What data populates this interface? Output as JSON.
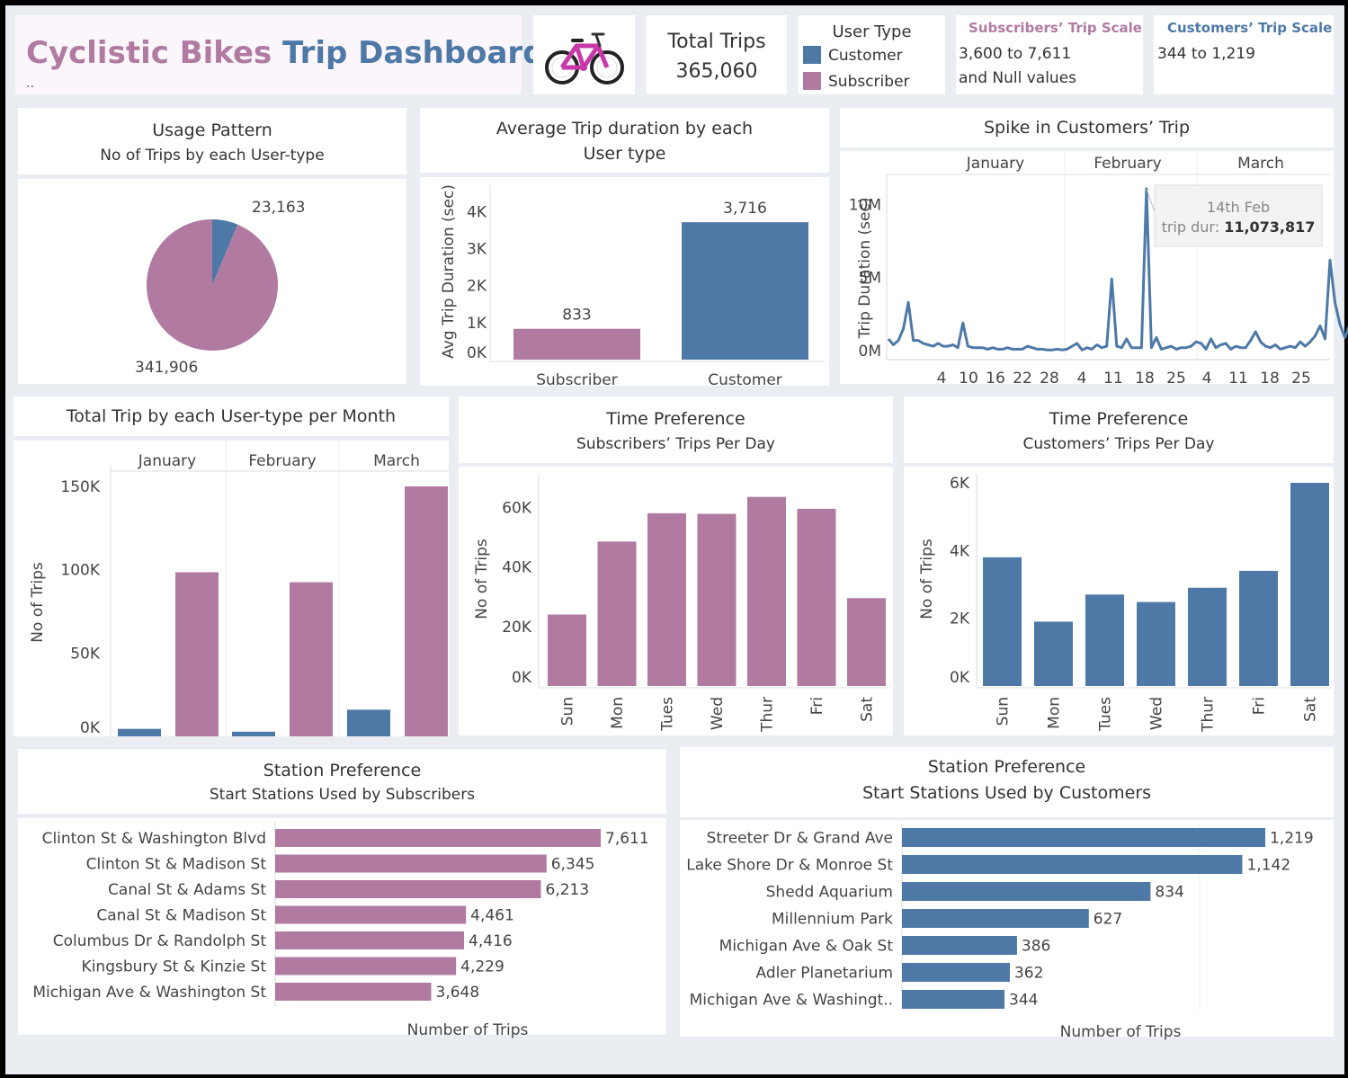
{
  "colors": {
    "customer": "#4e79a7",
    "subscriber": "#b07aa1"
  },
  "header": {
    "title_part1": "Cyclistic Bikes",
    "title_part2": "Trip Dashboard",
    "subtitle": "..",
    "bike_icon": "bicycle-icon",
    "total_label": "Total Trips",
    "total_value": "365,060",
    "legend_title": "User Type",
    "legend_items": [
      "Customer",
      "Subscriber"
    ],
    "sub_scale_title": "Subscribers’ Trip Scale",
    "sub_scale_line1": "3,600 to 7,611",
    "sub_scale_line2": "and Null values",
    "cust_scale_title": "Customers’ Trip Scale",
    "cust_scale_line1": "344 to 1,219"
  },
  "usage": {
    "title": "Usage Pattern",
    "subtitle": "No of Trips by each User-type"
  },
  "avg": {
    "title_line1": "Average Trip duration by each",
    "title_line2": "User type"
  },
  "spike": {
    "title": "Spike in Customers’ Trip",
    "tooltip_date": "14th Feb",
    "tooltip_label": "trip dur:",
    "tooltip_value": "11,073,817"
  },
  "monthly": {
    "title": "Total Trip by each User-type per Month"
  },
  "tp_sub": {
    "title": "Time Preference",
    "subtitle": "Subscribers’ Trips Per Day"
  },
  "tp_cust": {
    "title": "Time Preference",
    "subtitle": "Customers’ Trips Per Day"
  },
  "st_sub": {
    "title": "Station Preference",
    "subtitle": "Start Stations Used by Subscribers"
  },
  "st_cust": {
    "title": "Station Preference",
    "subtitle": "Start Stations Used by Customers"
  },
  "chart_data": [
    {
      "id": "usage_pie",
      "type": "pie",
      "labels": [
        "Customer",
        "Subscriber"
      ],
      "values": [
        23163,
        341906
      ],
      "value_labels": [
        "23,163",
        "341,906"
      ]
    },
    {
      "id": "avg_duration",
      "type": "bar",
      "categories": [
        "Subscriber",
        "Customer"
      ],
      "values": [
        833,
        3716
      ],
      "value_labels": [
        "833",
        "3,716"
      ],
      "ylabel": "Avg Trip Duration (sec)",
      "ylim": [
        0,
        4400
      ],
      "yticks": [
        0,
        1000,
        2000,
        3000,
        4000
      ],
      "ytick_labels": [
        "0K",
        "1K",
        "2K",
        "3K",
        "4K"
      ]
    },
    {
      "id": "spike_line",
      "type": "line",
      "months": [
        "January",
        "February",
        "March"
      ],
      "ylabel": "Trip Duration (sec)",
      "ylim": [
        0,
        11500000
      ],
      "yticks": [
        0,
        5000000,
        10000000
      ],
      "ytick_labels": [
        "0M",
        "5M",
        "10M"
      ],
      "x_tick_labels": [
        "4",
        "10",
        "16",
        "22",
        "28",
        "4",
        "11",
        "18",
        "25",
        "4",
        "11",
        "18",
        "25"
      ],
      "x": [
        1,
        2,
        3,
        4,
        5,
        6,
        7,
        8,
        9,
        10,
        11,
        12,
        13,
        14,
        15,
        16,
        17,
        18,
        19,
        20,
        21,
        22,
        23,
        24,
        25,
        26,
        27,
        28,
        29,
        30,
        31,
        32,
        33,
        34,
        35,
        36,
        37,
        38,
        39,
        40,
        41,
        42,
        43,
        44,
        45,
        46,
        47,
        48,
        49,
        50,
        51,
        52,
        53,
        54,
        55,
        56,
        57,
        58,
        59,
        60,
        61,
        62,
        63,
        64,
        65,
        66,
        67,
        68,
        69,
        70,
        71,
        72,
        73,
        74,
        75,
        76,
        77,
        78,
        79,
        80,
        81,
        82,
        83,
        84,
        85,
        86,
        87,
        88,
        89,
        90
      ],
      "y": [
        800000,
        400000,
        700000,
        1500000,
        3300000,
        700000,
        700000,
        500000,
        400000,
        300000,
        500000,
        300000,
        300000,
        400000,
        200000,
        1900000,
        300000,
        200000,
        200000,
        200000,
        100000,
        200000,
        100000,
        100000,
        200000,
        100000,
        100000,
        100000,
        300000,
        200000,
        100000,
        100000,
        50000,
        50000,
        100000,
        50000,
        100000,
        300000,
        500000,
        50000,
        200000,
        100000,
        400000,
        200000,
        300000,
        4900000,
        300000,
        200000,
        800000,
        200000,
        200000,
        200000,
        11073817,
        200000,
        900000,
        100000,
        200000,
        300000,
        100000,
        200000,
        200000,
        300000,
        600000,
        500000,
        100000,
        800000,
        200000,
        400000,
        500000,
        100000,
        300000,
        200000,
        200000,
        700000,
        1300000,
        600000,
        300000,
        200000,
        400000,
        100000,
        200000,
        300000,
        200000,
        600000,
        300000,
        600000,
        1000000,
        1700000,
        800000,
        6200000,
        3300000,
        1800000,
        900000,
        1800000,
        700000,
        300000,
        1000000,
        6200000,
        2100000,
        900000,
        1600000,
        3300000,
        2800000,
        5600000,
        2800000,
        1000000
      ]
    },
    {
      "id": "monthly",
      "type": "bar",
      "categories": [
        "January",
        "February",
        "March"
      ],
      "series": [
        {
          "name": "Customer",
          "values": [
            4500,
            2800,
            16000
          ]
        },
        {
          "name": "Subscriber",
          "values": [
            98500,
            92500,
            150000
          ]
        }
      ],
      "ylabel": "No of Trips",
      "ylim": [
        0,
        150000
      ],
      "yticks": [
        0,
        50000,
        100000,
        150000
      ],
      "ytick_labels": [
        "0K",
        "50K",
        "100K",
        "150K"
      ]
    },
    {
      "id": "subs_day",
      "type": "bar",
      "categories": [
        "Sun",
        "Mon",
        "Tues",
        "Wed",
        "Thur",
        "Fri",
        "Sat"
      ],
      "values": [
        24000,
        48500,
        58000,
        57800,
        63500,
        59500,
        29500
      ],
      "ylabel": "No of Trips",
      "ylim": [
        0,
        64000
      ],
      "yticks": [
        0,
        20000,
        40000,
        60000
      ],
      "ytick_labels": [
        "0K",
        "20K",
        "40K",
        "60K"
      ]
    },
    {
      "id": "cust_day",
      "type": "bar",
      "categories": [
        "Sun",
        "Mon",
        "Tues",
        "Wed",
        "Thur",
        "Fri",
        "Sat"
      ],
      "values": [
        3800,
        1900,
        2700,
        2480,
        2900,
        3400,
        6000
      ],
      "ylabel": "No of Trips",
      "ylim": [
        0,
        6000
      ],
      "yticks": [
        0,
        2000,
        4000,
        6000
      ],
      "ytick_labels": [
        "0K",
        "2K",
        "4K",
        "6K"
      ]
    },
    {
      "id": "subs_station",
      "type": "bar",
      "orientation": "horizontal",
      "categories": [
        "Clinton St & Washington Blvd",
        "Clinton St & Madison St",
        "Canal St & Adams St",
        "Canal St & Madison St",
        "Columbus Dr & Randolph St",
        "Kingsbury St & Kinzie St",
        "Michigan Ave & Washington St"
      ],
      "values": [
        7611,
        6345,
        6213,
        4461,
        4416,
        4229,
        3648
      ],
      "value_labels": [
        "7,611",
        "6,345",
        "6,213",
        "4,461",
        "4,416",
        "4,229",
        "3,648"
      ],
      "xlabel": "Number of Trips"
    },
    {
      "id": "cust_station",
      "type": "bar",
      "orientation": "horizontal",
      "categories": [
        "Streeter Dr & Grand Ave",
        "Lake Shore Dr & Monroe St",
        "Shedd Aquarium",
        "Millennium Park",
        "Michigan Ave & Oak St",
        "Adler Planetarium",
        "Michigan Ave & Washingt.."
      ],
      "values": [
        1219,
        1142,
        834,
        627,
        386,
        362,
        344
      ],
      "value_labels": [
        "1,219",
        "1,142",
        "834",
        "627",
        "386",
        "362",
        "344"
      ],
      "xlabel": "Number of Trips"
    }
  ]
}
